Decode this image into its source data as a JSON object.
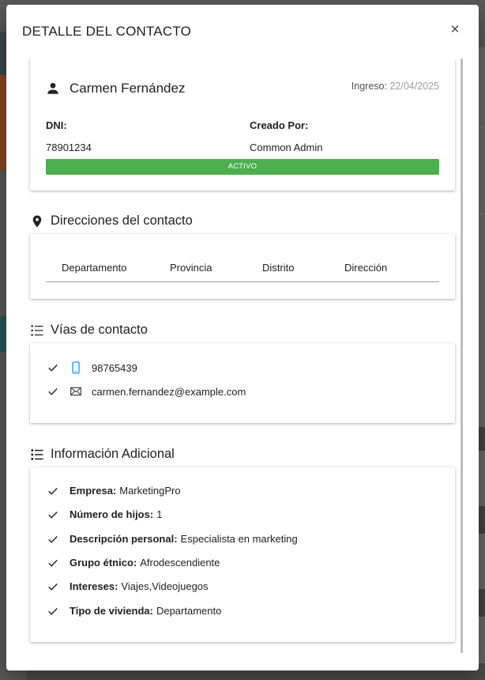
{
  "modal": {
    "title": "DETALLE DEL CONTACTO",
    "close_label": "×"
  },
  "contact": {
    "name": "Carmen Fernández",
    "ingreso_label": "Ingreso:",
    "ingreso_date": "22/04/2025",
    "dni_label": "DNI:",
    "dni_value": "78901234",
    "creado_label": "Creado Por:",
    "creado_value": "Common Admin",
    "status": "ACTIVO",
    "status_color": "#4caf50"
  },
  "addresses": {
    "title": "Direcciones del contacto",
    "columns": [
      "Departamento",
      "Provincia",
      "Distrito",
      "Dirección"
    ]
  },
  "contact_ways": {
    "title": "Vías de contacto",
    "items": [
      {
        "icon": "mobile-phone-icon",
        "value": "98765439"
      },
      {
        "icon": "envelope-icon",
        "value": "carmen.fernandez@example.com"
      }
    ]
  },
  "additional_info": {
    "title": "Información Adicional",
    "items": [
      {
        "label": "Empresa:",
        "value": "MarketingPro"
      },
      {
        "label": "Número de hijos:",
        "value": "1"
      },
      {
        "label": "Descripción personal:",
        "value": "Especialista en marketing"
      },
      {
        "label": "Grupo étnico:",
        "value": "Afrodescendiente"
      },
      {
        "label": "Intereses:",
        "value": "Viajes,Videojuegos"
      },
      {
        "label": "Tipo de vivienda:",
        "value": "Departamento"
      }
    ]
  },
  "colors": {
    "accent_blue": "#2196f3",
    "status_green": "#4caf50"
  }
}
